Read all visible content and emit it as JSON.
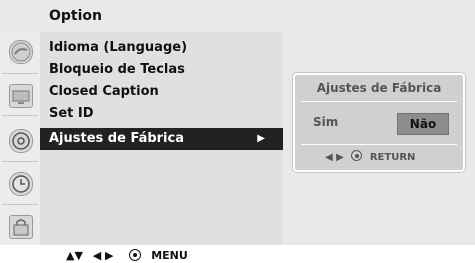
{
  "header": {
    "title": "Option"
  },
  "menu": {
    "items": [
      {
        "label": "Idioma (Language)"
      },
      {
        "label": "Bloqueio de Teclas"
      },
      {
        "label": "Closed Caption"
      },
      {
        "label": "Set ID"
      },
      {
        "label": "Ajustes de Fábrica",
        "selected": true,
        "arrow": "▶"
      }
    ]
  },
  "dialog": {
    "title": "Ajustes de Fábrica",
    "option_yes": "Sim",
    "option_no": "Não",
    "footer_arrows": "◀ ▶",
    "footer_return": "RETURN"
  },
  "footer": {
    "up_down": "▲▼",
    "left_right": "◀ ▶",
    "menu": "MENU"
  },
  "icons": [
    "picture-icon",
    "screen-icon",
    "cd-icon",
    "clock-icon",
    "lock-icon"
  ],
  "colors": {
    "selected_bg": "#222222",
    "selected_text": "#ffffff",
    "panel_bg": "#e0e0e0",
    "dialog_bg": "#d0d0d0"
  }
}
